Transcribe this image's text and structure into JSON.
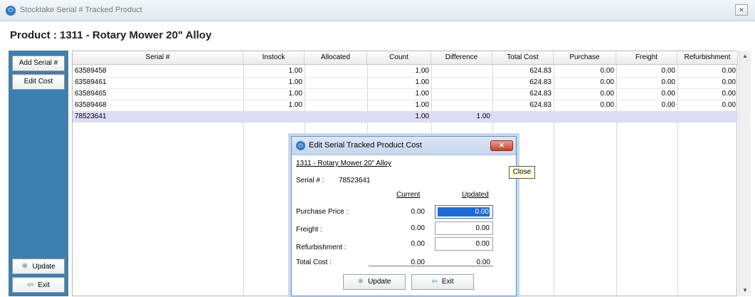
{
  "window": {
    "title": "Stocktake Serial # Tracked Product",
    "close_glyph": "✕",
    "app_icon": "power-icon"
  },
  "product_title": "Product : 1311 - Rotary Mower 20\" Alloy",
  "sidebar": {
    "add_serial": "Add Serial #",
    "edit_cost": "Edit Cost",
    "update": "Update",
    "exit": "Exit",
    "update_icon": "gear-spinner-icon",
    "exit_icon": "exit-icon"
  },
  "grid": {
    "columns": [
      "Serial #",
      "Instock",
      "Allocated",
      "Count",
      "Difference",
      "Total Cost",
      "Purchase",
      "Freight",
      "Refurbishment"
    ],
    "rows": [
      {
        "serial": "63589458",
        "instock": "1.00",
        "allocated": "",
        "count": "1.00",
        "difference": "",
        "total_cost": "624.83",
        "purchase": "0.00",
        "freight": "0.00",
        "refurbishment": "0.00"
      },
      {
        "serial": "63589461",
        "instock": "1.00",
        "allocated": "",
        "count": "1.00",
        "difference": "",
        "total_cost": "624.83",
        "purchase": "0.00",
        "freight": "0.00",
        "refurbishment": "0.00"
      },
      {
        "serial": "63589465",
        "instock": "1.00",
        "allocated": "",
        "count": "1.00",
        "difference": "",
        "total_cost": "624.83",
        "purchase": "0.00",
        "freight": "0.00",
        "refurbishment": "0.00"
      },
      {
        "serial": "63589468",
        "instock": "1.00",
        "allocated": "",
        "count": "1.00",
        "difference": "",
        "total_cost": "624.83",
        "purchase": "0.00",
        "freight": "0.00",
        "refurbishment": "0.00"
      },
      {
        "serial": "78523641",
        "instock": "",
        "allocated": "",
        "count": "1.00",
        "difference": "1.00",
        "total_cost": "",
        "purchase": "",
        "freight": "",
        "refurbishment": ""
      }
    ],
    "selected_row_color": "#dcdcf4"
  },
  "dialog": {
    "title": "Edit Serial Tracked Product Cost",
    "close_glyph": "✕",
    "product_link": "1311 - Rotary Mower 20\" Alloy",
    "serial_label": "Serial # :",
    "serial_value": "78523641",
    "current_header": "Current",
    "updated_header": "Updated",
    "purchase_label": "Purchase Price :",
    "purchase_current": "0.00",
    "purchase_updated": "0.00",
    "freight_label": "Freight :",
    "freight_current": "0.00",
    "freight_updated": "0.00",
    "refurb_label": "Refurbishment :",
    "refurb_current": "0.00",
    "refurb_updated": "0.00",
    "total_label": "Total Cost :",
    "total_current": "0.00",
    "total_updated": "0.00",
    "update_button": "Update",
    "exit_button": "Exit"
  },
  "tooltip": "Close",
  "colors": {
    "sidebar": "#3d7fb1",
    "selection": "#1e6ad6",
    "dialog_border": "#6f8fb3"
  }
}
